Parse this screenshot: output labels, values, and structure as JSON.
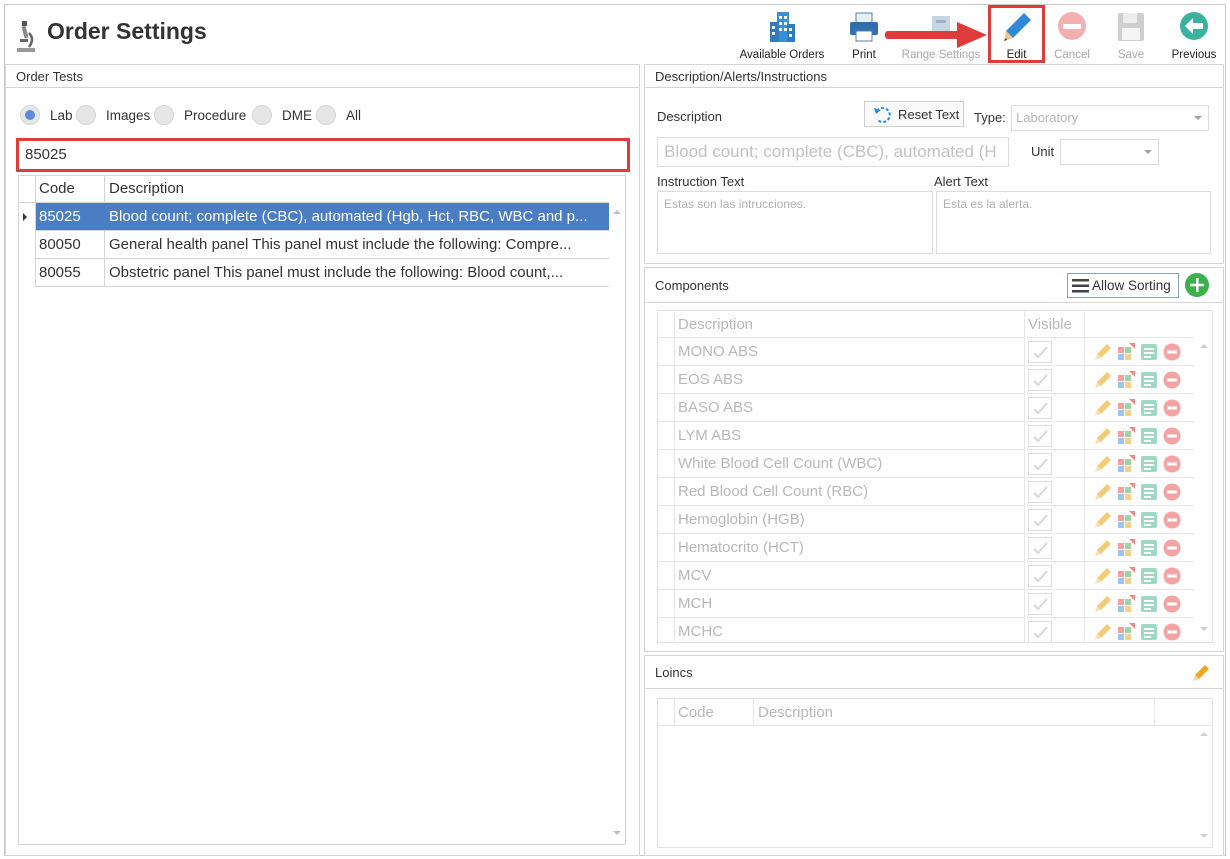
{
  "app": {
    "title": "Order Settings"
  },
  "toolbar": {
    "available_orders": "Available Orders",
    "print": "Print",
    "range_settings": "Range Settings",
    "edit": "Edit",
    "cancel": "Cancel",
    "save": "Save",
    "previous": "Previous"
  },
  "order_tests": {
    "title": "Order Tests",
    "radios": [
      {
        "label": "Lab",
        "selected": true
      },
      {
        "label": "Images",
        "selected": false
      },
      {
        "label": "Procedure",
        "selected": false
      },
      {
        "label": "DME",
        "selected": false
      },
      {
        "label": "All",
        "selected": false
      }
    ],
    "search_value": "85025",
    "columns": {
      "code": "Code",
      "description": "Description"
    },
    "rows": [
      {
        "code": "85025",
        "description": "Blood count; complete (CBC), automated (Hgb, Hct, RBC, WBC and p..."
      },
      {
        "code": "80050",
        "description": "General health panel This panel must include the following: Compre..."
      },
      {
        "code": "80055",
        "description": "Obstetric panel This panel must include the following: Blood count,..."
      }
    ]
  },
  "description_panel": {
    "title": "Description/Alerts/Instructions",
    "description_label": "Description",
    "reset_text": "Reset Text",
    "type_label": "Type:",
    "type_value": "Laboratory",
    "description_value": "Blood count; complete (CBC), automated (H",
    "unit_label": "Unit",
    "unit_value": "",
    "instruction_label": "Instruction Text",
    "instruction_value": "Estas son las intrucciones.",
    "alert_label": "Alert Text",
    "alert_value": "Esta es la alerta."
  },
  "components": {
    "title": "Components",
    "allow_sorting": "Allow Sorting",
    "columns": {
      "description": "Description",
      "visible": "Visible"
    },
    "rows": [
      "MONO ABS",
      "EOS ABS",
      "BASO ABS",
      "LYM ABS",
      "White Blood Cell Count (WBC)",
      "Red Blood Cell Count (RBC)",
      "Hemoglobin (HGB)",
      "Hematocrito (HCT)",
      "MCV",
      "MCH",
      "MCHC"
    ]
  },
  "loincs": {
    "title": "Loincs",
    "columns": {
      "code": "Code",
      "description": "Description"
    }
  },
  "colors": {
    "selection": "#4a7dc2",
    "highlight": "#e03b3b",
    "accent_green": "#3ab14a"
  }
}
